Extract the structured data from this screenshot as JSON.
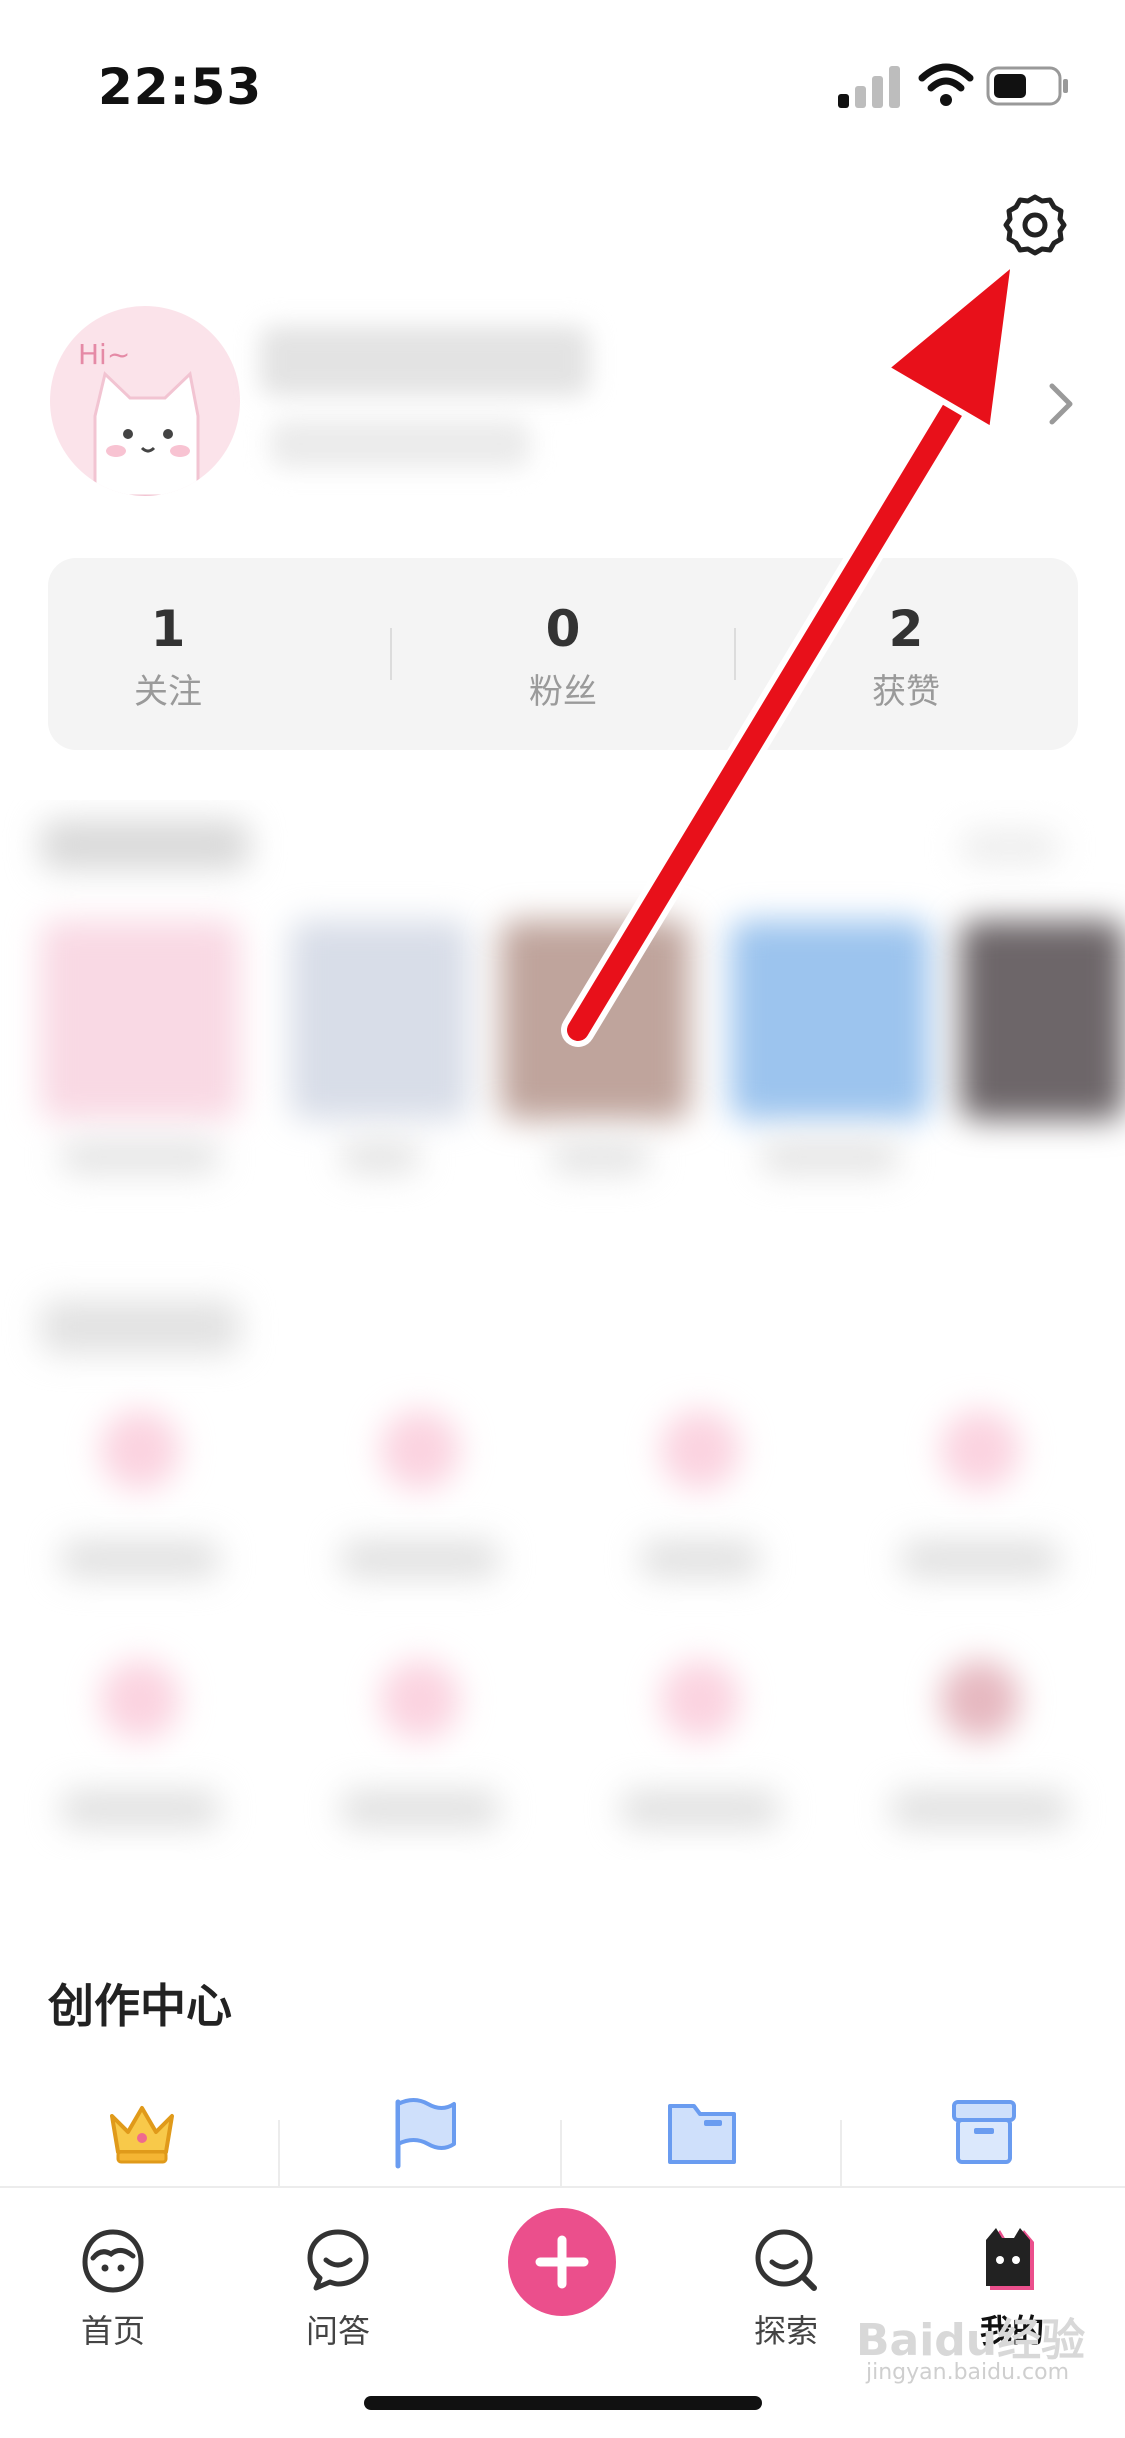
{
  "status_bar": {
    "time": "22:53"
  },
  "stats": [
    {
      "value": "1",
      "label": "关注"
    },
    {
      "value": "0",
      "label": "粉丝"
    },
    {
      "value": "2",
      "label": "获赞"
    }
  ],
  "creation_center": {
    "title": "创作中心"
  },
  "tabbar": [
    {
      "label": "首页"
    },
    {
      "label": "问答"
    },
    {
      "label": "探索"
    },
    {
      "label": "我的"
    }
  ],
  "watermark": {
    "text": "Baidu经验",
    "url": "jingyan.baidu.com"
  },
  "colors": {
    "accent": "#eb4f8c",
    "arrow": "#e8101a",
    "crown": "#f5b533",
    "blue_icon": "#6a9cf0"
  },
  "icons": [
    "signal-icon",
    "wifi-icon",
    "battery-icon",
    "gear-icon",
    "chevron-right-icon",
    "crown-icon",
    "flag-icon",
    "folder-icon",
    "box-icon",
    "home-tab-icon",
    "qa-tab-icon",
    "plus-icon",
    "explore-tab-icon",
    "me-tab-icon"
  ]
}
